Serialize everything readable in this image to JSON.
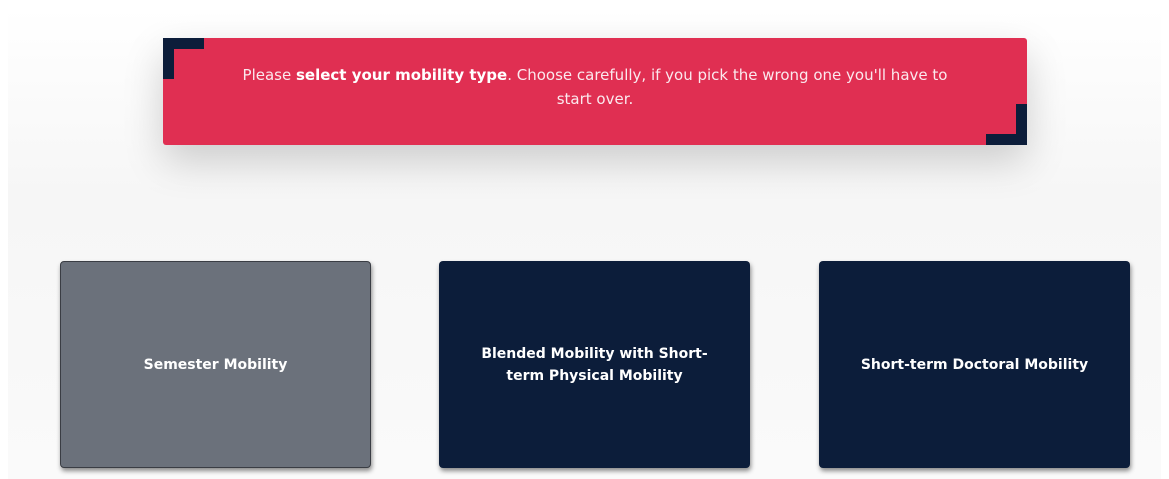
{
  "notice": {
    "text_prefix": "Please ",
    "text_bold": "select your mobility type",
    "text_suffix": ". Choose carefully, if you pick the wrong one you'll have to start over."
  },
  "options": [
    {
      "label": "Semester Mobility",
      "state": "disabled"
    },
    {
      "label": "Blended Mobility with Short-term Physical Mobility",
      "state": "active"
    },
    {
      "label": "Short-term Doctoral Mobility",
      "state": "active"
    }
  ],
  "colors": {
    "notice_bg": "#e02f52",
    "accent_dark": "#0c1d3a",
    "card_disabled": "#6b717b"
  }
}
